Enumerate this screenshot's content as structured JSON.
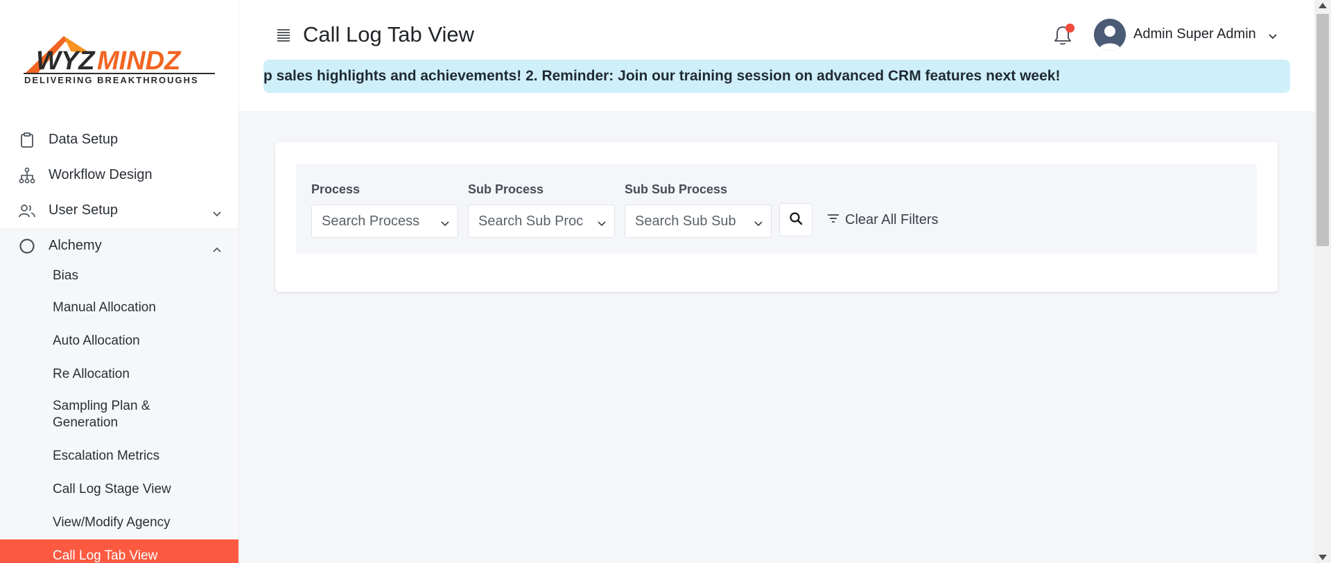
{
  "brand": {
    "logo_text": "WYZMINDZ",
    "logo_text_dark": "WYZ",
    "logo_text_accent": "MINDZ",
    "tagline": "DELIVERING  BREAKTHROUGHS",
    "accent_color": "#fb5a40"
  },
  "sidebar": {
    "items": [
      {
        "label": "Data Setup",
        "icon": "clipboard-icon"
      },
      {
        "label": "Workflow Design",
        "icon": "hierarchy-icon"
      },
      {
        "label": "User Setup",
        "icon": "users-icon"
      },
      {
        "label": "Alchemy",
        "icon": "circle-icon"
      }
    ],
    "alchemy_sub": [
      "Bias",
      "Manual Allocation",
      "Auto Allocation",
      "Re Allocation",
      "Sampling Plan & Generation",
      "Escalation Metrics",
      "Call Log Stage View",
      "View/Modify Agency",
      "Call Log Tab View"
    ]
  },
  "header": {
    "title": "Call Log Tab View",
    "user_name": "Admin Super Admin",
    "ticker": "p sales highlights and achievements! 2. Reminder: Join our training session on advanced CRM features next week!"
  },
  "filters": {
    "process_label": "Process",
    "process_placeholder": "Search Process",
    "sub_process_label": "Sub Process",
    "sub_process_placeholder": "Search Sub Proc",
    "sub_sub_process_label": "Sub Sub Process",
    "sub_sub_process_placeholder": "Search Sub Sub",
    "clear_label": "Clear All Filters"
  }
}
